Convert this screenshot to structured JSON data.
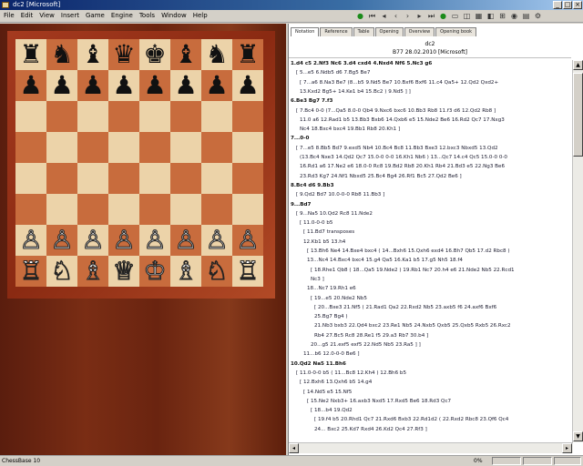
{
  "window": {
    "title": "dc2 [Microsoft]",
    "buttons": [
      "_",
      "□",
      "×"
    ]
  },
  "menu": [
    "File",
    "Edit",
    "View",
    "Insert",
    "Game",
    "Engine",
    "Tools",
    "Window",
    "Help"
  ],
  "toolbar_icons": [
    "go-icon",
    "back-start-icon",
    "back-icon",
    "back-step-icon",
    "forward-step-icon",
    "forward-icon",
    "forward-end-icon",
    "green-go-icon",
    "tool-icon-1",
    "tool-icon-2",
    "tool-icon-3",
    "tool-icon-4",
    "tool-icon-5",
    "tool-icon-6",
    "tool-icon-7",
    "tool-icon-8"
  ],
  "board": {
    "ranks": [
      [
        "♜",
        "♞",
        "♝",
        "♛",
        "♚",
        "♝",
        "♞",
        "♜"
      ],
      [
        "♟",
        "♟",
        "♟",
        "♟",
        "♟",
        "♟",
        "♟",
        "♟"
      ],
      [
        "",
        "",
        "",
        "",
        "",
        "",
        "",
        ""
      ],
      [
        "",
        "",
        "",
        "",
        "",
        "",
        "",
        ""
      ],
      [
        "",
        "",
        "",
        "",
        "",
        "",
        "",
        ""
      ],
      [
        "",
        "",
        "",
        "",
        "",
        "",
        "",
        ""
      ],
      [
        "♙",
        "♙",
        "♙",
        "♙",
        "♙",
        "♙",
        "♙",
        "♙"
      ],
      [
        "♖",
        "♘",
        "♗",
        "♕",
        "♔",
        "♗",
        "♘",
        "♖"
      ]
    ]
  },
  "tabs": [
    "Notation",
    "Reference",
    "Table",
    "Opening",
    "Overview",
    "Opening book"
  ],
  "game": {
    "title": "dc2",
    "info": "B77  28.02.2010 [Microsoft]"
  },
  "moves": [
    "1.d4  c5  2.Nf3  Nc6  3.d4  cxd4  4.Nxd4  Nf6  5.Nc3  g6",
    "[ 5...e5  6.Ndb5  d6  7.Bg5  Be7",
    "[ 7...a6  8.Na3  Be7  (8...b5  9.Nd5  Be7  10.Bxf6  Bxf6  11.c4  Qa5+  12.Qd2  Qxd2+",
    "13.Kxd2  Bg5+  14.Ke1  b4  15.Bc2 )  9.Nd5 ] ]",
    "6.Be3  Bg7  7.f3",
    "[ 7.Bc4  0-0  (7...Qa5  8.0-0  Qb4  9.Nxc6  bxc6  10.Bb3  Rb8  11.f3  d6  12.Qd2  Rb8 ]",
    "11.0  a6  12.Rad1  b5  13.Bb3  Bxb6  14.Qxb6  e5  15.Nde2  Be6  16.Rd2  Qc7  17.Nxg3",
    "Nc4  18.Bxc4  bxc4  19.Bb1  Rb8  20.Kh1 ]",
    "7...0-0",
    "[ 7...e5  8.Bb5  Bd7  9.exd5  Nb4  10.Bc4  Bc8  11.Bb3  Bxe3  12.bxc3  Nbxd5  13.Qd2",
    "(13.Bc4  Nxe3  14.Qd2  Qc7  15.0-0  0-0  16.Kh1  Nb6 )  13...Qc7  14.c4  Qc5  15.0-0  0-0",
    "16.Rd1  a6  17.Ne2  e6  18.0-0  Rc8  19.Bd2  Rb8  20.Kh1  Rb4  21.Bd3  e5  22.Ng3  Be6",
    "23.Rd3  Kg7  24.Nf1  Nbxd5  25.Bc4  Bg4  26.Rf1  Bc5  27.Qd2  Be6 ]",
    "8.Bc4  d6  9.Bb3",
    "[ 9.Qd2  Bd7  10.0-0-0  Rb8  11.Bb3 ]",
    "9...Bd7",
    "[ 9...Na5  10.Qd2  Rc8  11.Nde2",
    "[ 11.0-0-0  b5",
    "[ 11.Bd7  transposes",
    "12.Kb1  b5  13.h4",
    "[ 13.Bh6  Ne4  14.Bxe4  bxc4  ( 14...Bxh6  15.Qxh6  exd4  16.Bh7  Qb5  17.d2  Rbc8 )",
    "13...Nc4  14.Bxc4  bxc4  15.g4  Qa5  16.Ka1  b5  17.g5  Nh5  18.f4",
    "[ 18.Rhe1  Qb8  ( 18...Qa5  19.Nde2 )  19.Rb1  Nc7  20.h4  e6  21.Nde2  Nb5  22.Rcd1",
    "Nc3 ]",
    "18...Nc7  19.Rh1  e6",
    "[ 19...e5  20.Nde2  Nb5",
    "[ 20...Bxe3  21.Nf5  ( 21.Rad1  Qa2  22.Rxd2  Nb5  23.axb5  f6  24.axf6  Bxf6",
    "25.Bg7  Bg4 )",
    "21.Nb3  bxb3  22.Qd4  bxc2  23.Re1  Nb5  24.Nxb5  Qxb5  25.Qxb5  Rxb5  26.Rxc2",
    "Rb4  27.Bc5  Rc8  28.Re1  f5  29.a3  Rb7  30.b4 ]",
    "20...g5  21.exf5  exf5  22.Nd5  Nb5  23.Ra5 ] ]",
    "11...b6  12.0-0-0  Be6 ]",
    "10.Qd2  Na5  11.Bh6",
    "[ 11.0-0-0  b5  ( 11...Bc8  12.Kh4 )  12.Bh6  b5",
    "[ 12.Bxh6  13.Qxh6  b5  14.g4",
    "[ 14.Nd5  e5  15.Nf5",
    "[ 15.Ne2  Nxb3+  16.axb3  Nxd5  17.Rxd5  Be6  18.Rd3  Qc7",
    "[ 18...b4  19.Qd2",
    "[ 19.f4  b5  20.Rhd1  Qc7  21.Rxd6  Bxb3  22.Rd1d2  ( 22.Rxd2  Rbc8  23.Qf6  Qc4",
    "24...  Bxc2  25.Kd7  Rxd4  26.Kd2  Qc4  27.Rf3 ]"
  ],
  "status": {
    "left": "ChessBase 10",
    "pct": "0%"
  }
}
